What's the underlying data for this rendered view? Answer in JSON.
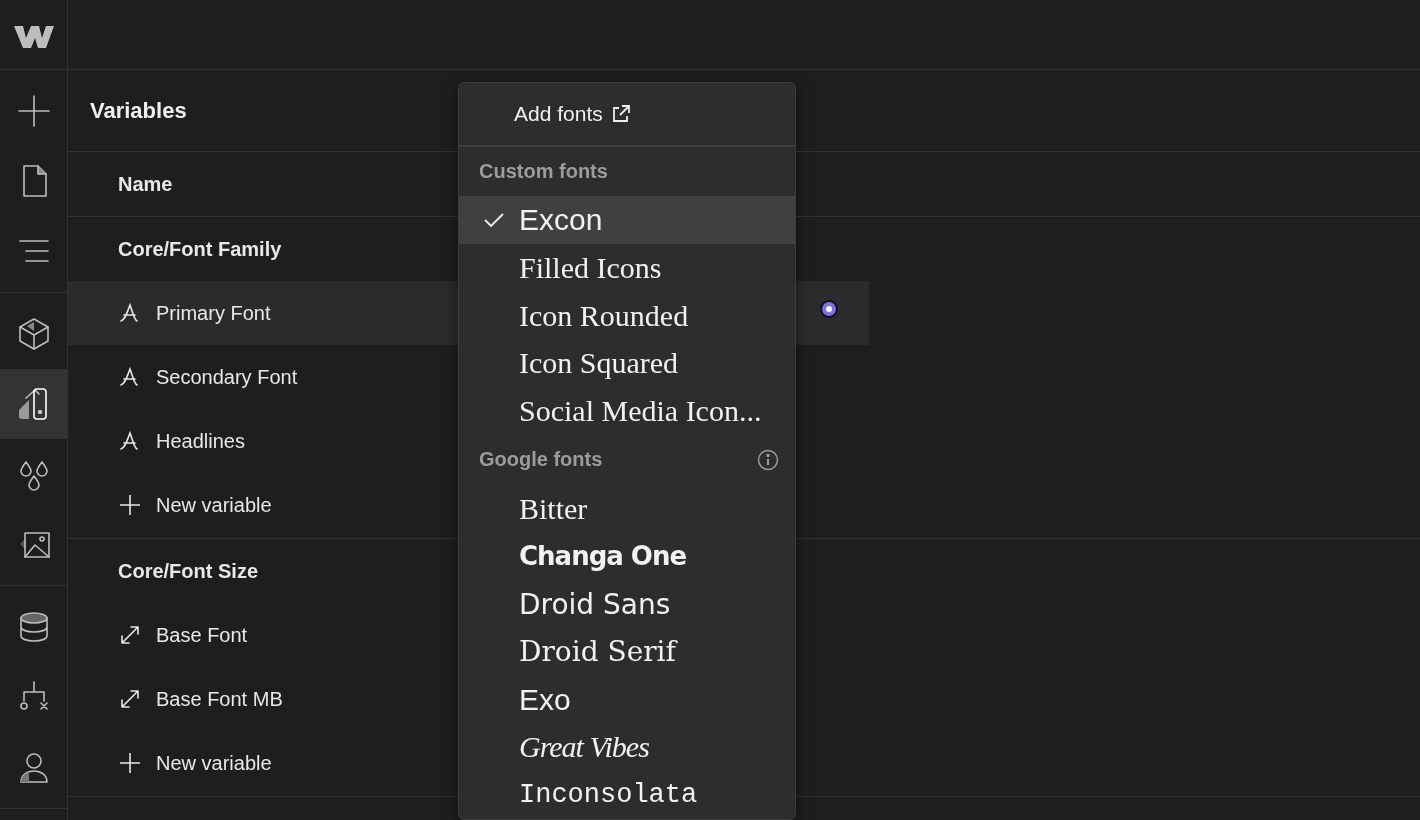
{
  "rail": [
    {
      "kind": "add",
      "selected": false
    },
    {
      "kind": "page",
      "selected": false
    },
    {
      "kind": "navigator",
      "selected": false
    },
    {
      "kind": "components",
      "selected": false
    },
    {
      "kind": "variables",
      "selected": true
    },
    {
      "kind": "colors",
      "selected": false
    },
    {
      "kind": "assets",
      "selected": false
    },
    {
      "kind": "cms",
      "selected": false
    },
    {
      "kind": "logic",
      "selected": false
    },
    {
      "kind": "users",
      "selected": false
    }
  ],
  "panel": {
    "title": "Variables",
    "column": "Name",
    "groups": [
      {
        "name": "Core/Font Family",
        "add_label": "New variable",
        "variables": [
          {
            "kind": "font",
            "name": "Primary Font",
            "selected": true
          },
          {
            "kind": "font",
            "name": "Secondary Font",
            "selected": false
          },
          {
            "kind": "font",
            "name": "Headlines",
            "selected": false
          }
        ]
      },
      {
        "name": "Core/Font Size",
        "add_label": "New variable",
        "variables": [
          {
            "kind": "size",
            "name": "Base Font",
            "selected": false
          },
          {
            "kind": "size",
            "name": "Base Font MB",
            "selected": false
          }
        ]
      }
    ]
  },
  "font_menu": {
    "action": "Add fonts",
    "sections": [
      {
        "title": "Custom fonts",
        "info": false,
        "fonts": [
          {
            "name": "Excon",
            "kind": "sans",
            "selected": true
          },
          {
            "name": "Filled Icons",
            "kind": "serif",
            "selected": false
          },
          {
            "name": "Icon Rounded",
            "kind": "serif",
            "selected": false
          },
          {
            "name": "Icon Squared",
            "kind": "serif",
            "selected": false
          },
          {
            "name": "Social Media Icon...",
            "kind": "serif",
            "selected": false
          }
        ]
      },
      {
        "title": "Google fonts",
        "info": true,
        "fonts": [
          {
            "name": "Bitter",
            "kind": "serif",
            "selected": false
          },
          {
            "name": "Changa One",
            "kind": "display",
            "selected": false
          },
          {
            "name": "Droid Sans",
            "kind": "humanist",
            "selected": false
          },
          {
            "name": "Droid Serif",
            "kind": "slab",
            "selected": false
          },
          {
            "name": "Exo",
            "kind": "sans",
            "selected": false
          },
          {
            "name": "Great Vibes",
            "kind": "script",
            "selected": false
          },
          {
            "name": "Inconsolata",
            "kind": "mono",
            "selected": false
          }
        ]
      }
    ]
  }
}
